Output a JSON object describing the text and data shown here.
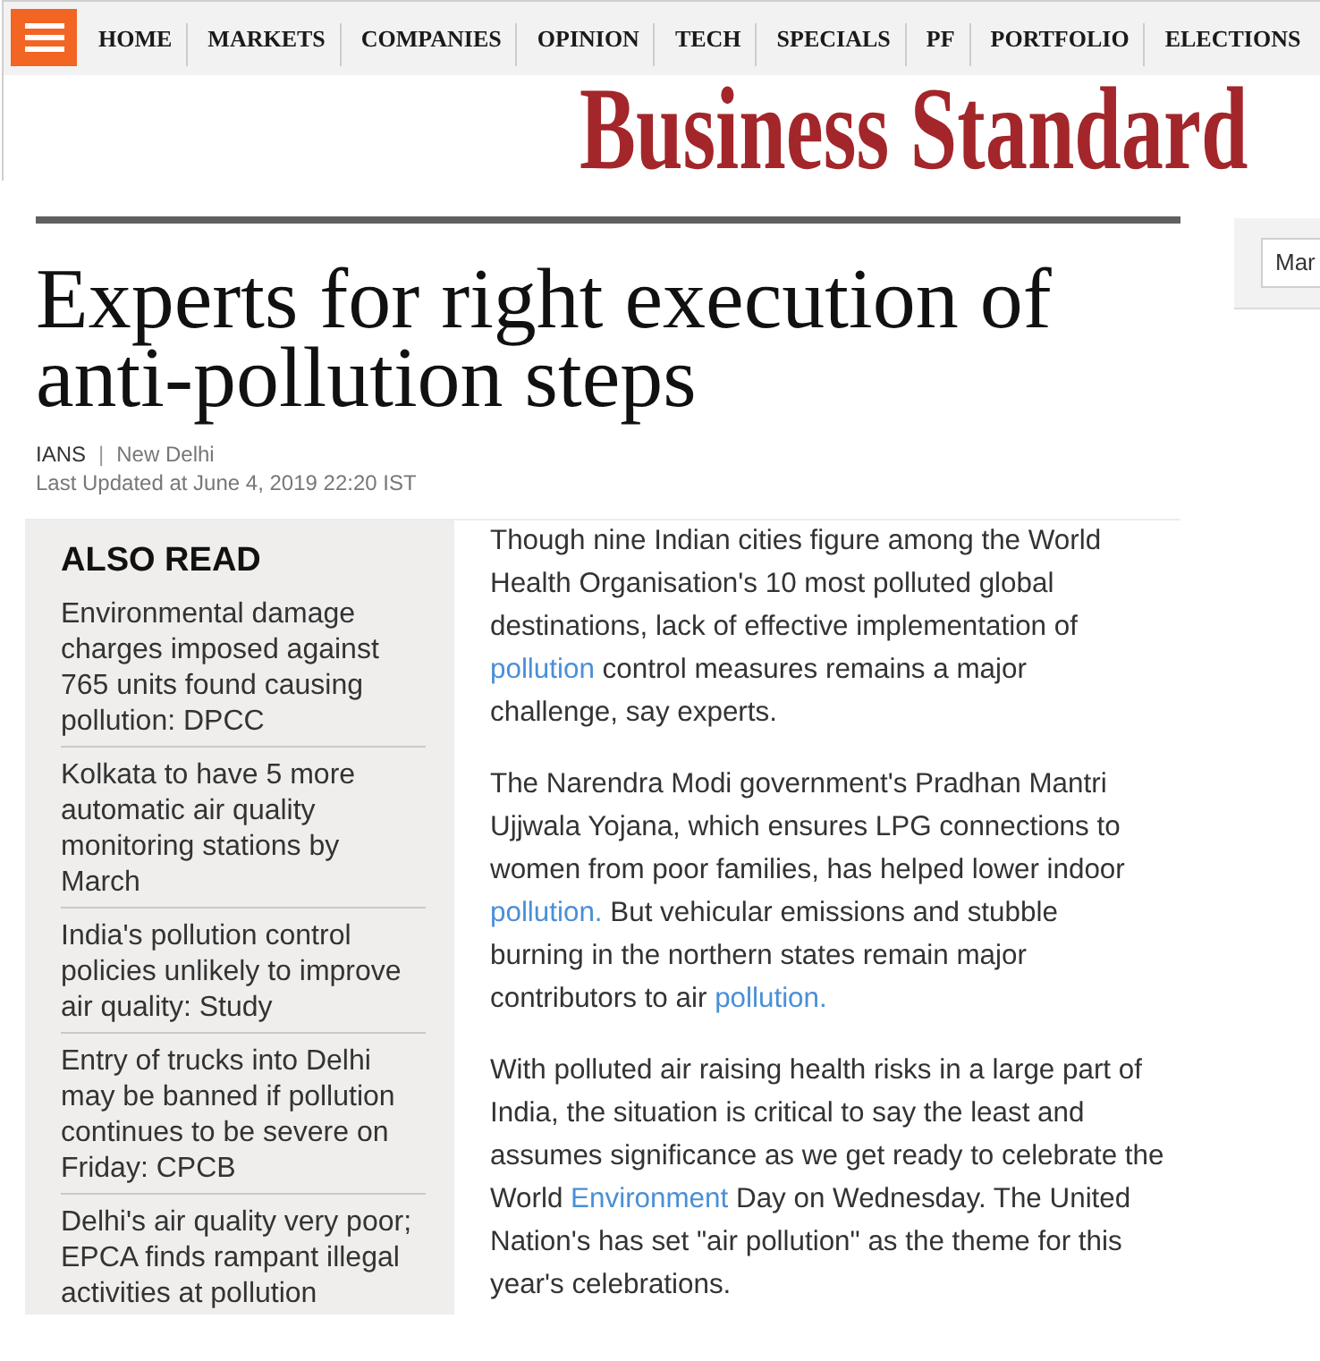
{
  "nav": {
    "items": [
      "HOME",
      "MARKETS",
      "COMPANIES",
      "OPINION",
      "TECH",
      "SPECIALS",
      "PF",
      "PORTFOLIO",
      "ELECTIONS"
    ]
  },
  "logo": "Business Standard",
  "right_panel": {
    "field": {
      "value": "Mar"
    }
  },
  "article": {
    "headline": "Experts for right execution of anti-pollution steps",
    "byline": {
      "source": "IANS",
      "separator": "|",
      "location": "New Delhi"
    },
    "updated": "Last Updated at June 4, 2019 22:20 IST",
    "paragraphs": [
      [
        {
          "text": "Though nine Indian cities figure among the World Health Organisation's 10 most polluted global destinations, lack of effective implementation of ",
          "link": false
        },
        {
          "text": "pollution",
          "link": true
        },
        {
          "text": " control measures remains a major challenge, say experts.",
          "link": false
        }
      ],
      [
        {
          "text": "The Narendra Modi government's Pradhan Mantri Ujjwala Yojana, which ensures LPG connections to women from poor families, has helped lower indoor ",
          "link": false
        },
        {
          "text": "pollution.",
          "link": true
        },
        {
          "text": " But vehicular emissions and stubble burning in the northern states remain major contributors to air ",
          "link": false
        },
        {
          "text": "pollution.",
          "link": true
        }
      ],
      [
        {
          "text": "With polluted air raising health risks in a large part of India, the situation is critical to say the least and assumes significance as we get ready to celebrate the World ",
          "link": false
        },
        {
          "text": "Environment",
          "link": true
        },
        {
          "text": " Day on Wednesday. The United Nation's has set \"air pollution\" as the theme for this year's celebrations.",
          "link": false
        }
      ]
    ]
  },
  "also_read": {
    "title": "ALSO READ",
    "items": [
      "Environmental damage charges imposed against 765 units found causing pollution: DPCC",
      "Kolkata to have 5 more automatic air quality monitoring stations by March",
      "India's pollution control policies unlikely to improve air quality: Study",
      "Entry of trucks into Delhi may be banned if pollution continues to be severe on Friday: CPCB",
      "Delhi's air quality very poor; EPCA finds rampant illegal activities at pollution"
    ]
  }
}
